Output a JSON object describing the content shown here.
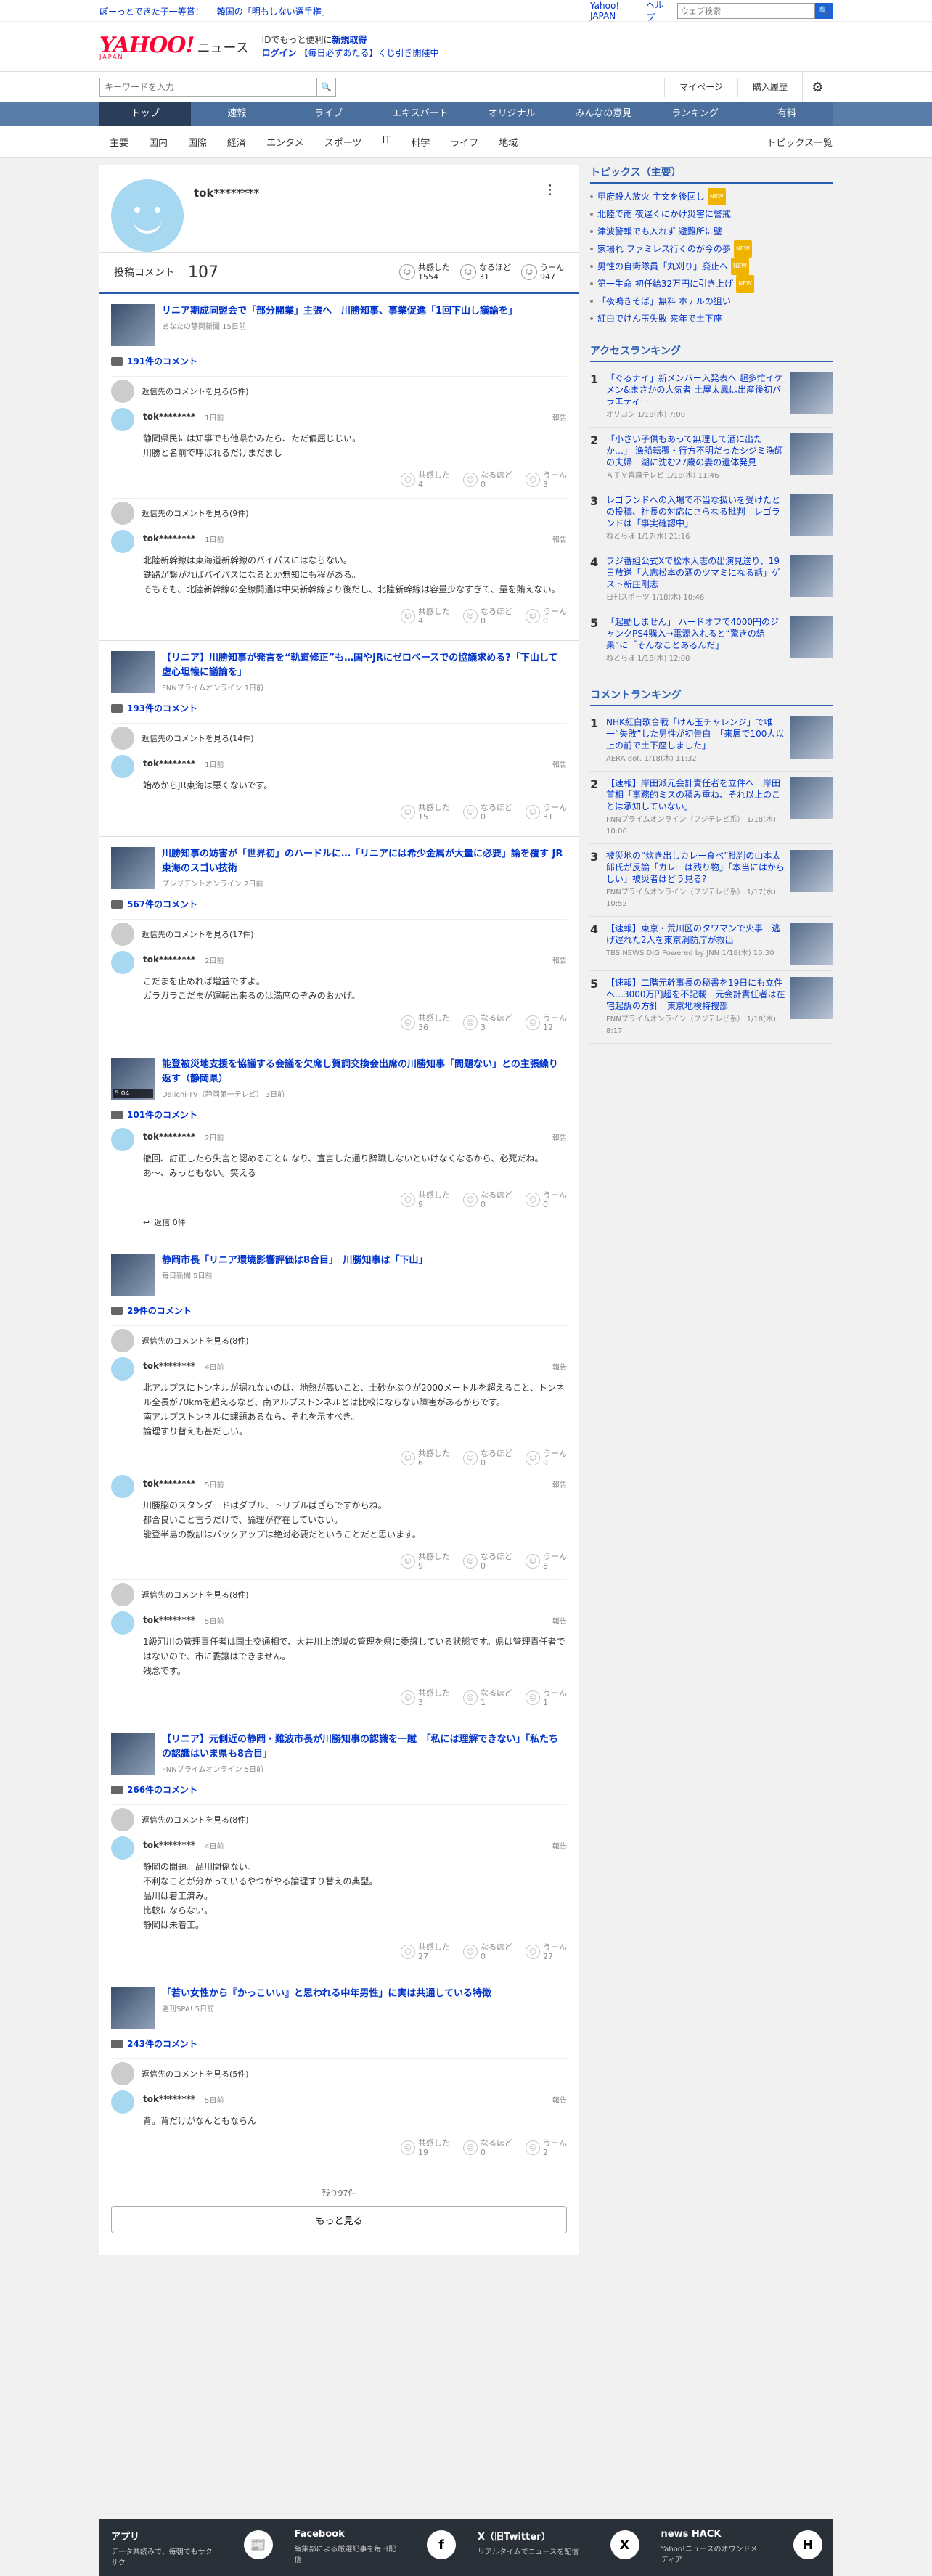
{
  "promo_links": [
    "ぽーっとできた子一等賞！",
    "韓国の「明もしない選手権」"
  ],
  "top_links": {
    "yahoo": "Yahoo! JAPAN",
    "help": "ヘルプ",
    "web_search_placeholder": "ウェブ検索"
  },
  "logo": {
    "main": "YAHOO!",
    "sub": "JAPAN",
    "service": "ニュース"
  },
  "header_note": {
    "line1": "IDでもっと便利に",
    "line1_link": "新規取得",
    "login": "ログイン",
    "lottery": "【毎日必ずあたる】くじ引き開催中"
  },
  "search": {
    "placeholder": "キーワードを入力"
  },
  "header_links": {
    "mypage": "マイページ",
    "purchase": "購入履歴"
  },
  "cat_tabs": [
    "トップ",
    "速報",
    "ライブ",
    "エキスパート",
    "オリジナル",
    "みんなの意見",
    "ランキング",
    "有料"
  ],
  "sub_tabs": [
    "主要",
    "国内",
    "国際",
    "経済",
    "エンタメ",
    "スポーツ",
    "IT",
    "科学",
    "ライフ",
    "地域"
  ],
  "sub_more": "トピックス一覧",
  "profile": {
    "name": "tok********",
    "post_label": "投稿コメント",
    "post_count": "107",
    "reacts": [
      {
        "label": "共感した",
        "count": "1554"
      },
      {
        "label": "なるほど",
        "count": "31"
      },
      {
        "label": "うーん",
        "count": "947"
      }
    ]
  },
  "articles": [
    {
      "title": "リニア期成同盟会で「部分開業」主張へ　川勝知事、事業促進「1回下山し議論を」",
      "source": "あなたの静岡新聞 15日前",
      "count": "191件のコメント",
      "threads": [
        {
          "reply": "返信先のコメントを見る(5件)",
          "time": "1日前",
          "body": "静岡県民には知事でも他県かみたら、ただ偏屈じじい。\n川勝と名前で呼ばれるだけまだまし",
          "r": [
            "共感した\n4",
            "なるほど\n0",
            "うーん\n3"
          ]
        },
        {
          "reply": "返信先のコメントを見る(9件)",
          "time": "1日前",
          "body": "北陸新幹線は東海道新幹線のバイパスにはならない。\n鉄路が繋がればバイパスになるとか無知にも程がある。\nそもそも、北陸新幹線の全線開通は中央新幹線より後だし、北陸新幹線は容量少なすぎて、量を賄えない。",
          "r": [
            "共感した\n4",
            "なるほど\n0",
            "うーん\n0"
          ]
        }
      ]
    },
    {
      "title": "【リニア】川勝知事が発言を“軌道修正”も…国やJRにゼロベースでの協議求める?「下山して虚心坦懐に議論を」",
      "source": "FNNプライムオンライン 1日前",
      "count": "193件のコメント",
      "threads": [
        {
          "reply": "返信先のコメントを見る(14件)",
          "time": "1日前",
          "body": "始めからJR東海は悪くないです。",
          "r": [
            "共感した\n15",
            "なるほど\n0",
            "うーん\n31"
          ]
        }
      ]
    },
    {
      "title": "川勝知事の妨害が「世界初」のハードルに…「リニアには希少金属が大量に必要」論を覆す JR東海のスゴい技術",
      "source": "プレジデントオンライン 2日前",
      "count": "567件のコメント",
      "threads": [
        {
          "reply": "返信先のコメントを見る(17件)",
          "time": "2日前",
          "body": "こだまを止めれば増益ですよ。\nガラガラこだまが運転出来るのは満席のぞみのおかげ。",
          "r": [
            "共感した\n36",
            "なるほど\n3",
            "うーん\n12"
          ]
        }
      ]
    },
    {
      "title": "能登被災地支援を協議する会議を欠席し賀詞交換会出席の川勝知事「問題ない」との主張繰り返す（静岡県）",
      "source": "Daiichi-TV（静岡第一テレビ） 3日前",
      "count": "101件のコメント",
      "video": "5:04",
      "threads": [
        {
          "reply": "",
          "time": "2日前",
          "body": "撤回、訂正したら失言と認めることになり、宣言した通り辞職しないといけなくなるから、必死だね。\nあ～、みっともない。笑える",
          "r": [
            "共感した\n9",
            "なるほど\n0",
            "うーん\n0"
          ]
        }
      ],
      "replies": "返信 0件"
    },
    {
      "title": "静岡市長「リニア環境影響評価は8合目」　川勝知事は「下山」",
      "source": "毎日新聞 5日前",
      "count": "29件のコメント",
      "threads": [
        {
          "reply": "返信先のコメントを見る(8件)",
          "time": "4日前",
          "body": "北アルプスにトンネルが掘れないのは、地熱が高いこと、土砂かぶりが2000メートルを超えること、トンネル全長が70kmを超えるなど、南アルプストンネルとは比較にならない障害があるからです。\n南アルプストンネルに課題あるなら、それを示すべき。\n論理すり替えも甚だしい。",
          "r": [
            "共感した\n6",
            "なるほど\n0",
            "うーん\n9"
          ]
        },
        {
          "reply": "",
          "time": "5日前",
          "body": "川勝脳のスタンダードはダブル、トリプルばざらですからね。\n都合良いこと言うだけで、論理が存在していない。\n能登半島の教訓はバックアップは絶対必要だということだと思います。",
          "r": [
            "共感した\n9",
            "なるほど\n0",
            "うーん\n8"
          ]
        },
        {
          "reply": "返信先のコメントを見る(8件)",
          "time": "5日前",
          "body": "1級河川の管理責任者は国土交通相で、大井川上流域の管理を県に委譲している状態です。県は管理責任者ではないので、市に委譲はできません。\n残念です。",
          "r": [
            "共感した\n3",
            "なるほど\n1",
            "うーん\n1"
          ]
        }
      ]
    },
    {
      "title": "【リニア】元側近の静岡・難波市長が川勝知事の認識を一蹴　「私には理解できない」「私たちの認識はいま県も8合目」",
      "source": "FNNプライムオンライン 5日前",
      "count": "266件のコメント",
      "threads": [
        {
          "reply": "返信先のコメントを見る(8件)",
          "time": "4日前",
          "body": "静岡の問題。品川関係ない。\n不利なことが分かっているやつがやる論理すり替えの典型。\n品川は着工済み。\n比較にならない。\n静岡は未着工。",
          "r": [
            "共感した\n27",
            "なるほど\n0",
            "うーん\n27"
          ]
        }
      ]
    },
    {
      "title": "「若い女性から『かっこいい』と思われる中年男性」に実は共通している特徴",
      "source": "週刊SPA! 5日前",
      "count": "243件のコメント",
      "threads": [
        {
          "reply": "返信先のコメントを見る(5件)",
          "time": "5日前",
          "body": "背。背だけがなんともならん",
          "r": [
            "共感した\n19",
            "なるほど\n0",
            "うーん\n2"
          ]
        }
      ]
    }
  ],
  "load_more": {
    "rest": "残り97件",
    "button": "もっと見る"
  },
  "report_label": "報告",
  "topics": {
    "title": "トピックス（主要）",
    "items": [
      {
        "t": "甲府殺人放火 主文を後回し",
        "b": "NEW"
      },
      {
        "t": "北陸で雨 夜遅くにかけ災害に警戒",
        "b": ""
      },
      {
        "t": "津波警報でも入れず 避難所に壁",
        "b": ""
      },
      {
        "t": "家場れ ファミレス行くのが今の夢",
        "b": "NEW"
      },
      {
        "t": "男性の自衛隊員「丸刈り」廃止へ",
        "b": "NEW"
      },
      {
        "t": "第一生命 初任給32万円に引き上げ",
        "b": "NEW"
      },
      {
        "t": "「夜鳴きそば」無料 ホテルの狙い",
        "b": ""
      },
      {
        "t": "紅白でけん玉失敗 来年で土下座",
        "b": ""
      }
    ]
  },
  "access_rank": {
    "title": "アクセスランキング",
    "items": [
      {
        "t": "「ぐるナイ」新メンバー入発表へ 超多忙イケメン&まさかの人気者 土屋太鳳は出産後初バラエティー",
        "s": "オリコン 1/18(木) 7:00"
      },
      {
        "t": "「小さい子供もあって無理して酒に出たか…」 漁船転覆・行方不明だったシジミ漁師の夫婦　湖に沈む27歳の妻の遺体発見",
        "s": "ＡＴＶ青森テレビ 1/18(木) 11:46"
      },
      {
        "t": "レゴランドへの入場で不当な扱いを受けたとの投稿、社長の対応にさらなる批判　レゴランドは「事実確認中」",
        "s": "ねとらぼ 1/17(水) 21:16"
      },
      {
        "t": "フジ番組公式Xで松本人志の出演見送り、19日放送「人志松本の酒のツマミになる話」ゲスト新庄剛志",
        "s": "日刊スポーツ 1/18(木) 10:46"
      },
      {
        "t": "「起動しません」 ハードオフで4000円のジャンクPS4購入→電源入れると“驚きの結果”に「そんなことあるんだ」",
        "s": "ねとらぼ 1/18(木) 12:00"
      }
    ]
  },
  "comment_rank": {
    "title": "コメントランキング",
    "items": [
      {
        "t": "NHK紅白歌合戦「けん玉チャレンジ」で唯一“失敗”した男性が初告白　「来層で100人以上の前で土下座しました」",
        "s": "AERA dot. 1/18(木) 11:32"
      },
      {
        "t": "【速報】岸田派元会計責任者を立件へ　岸田首相「事務的ミスの積み重ね、それ以上のことは承知していない」",
        "s": "FNNプライムオンライン（フジテレビ系） 1/18(木) 10:06"
      },
      {
        "t": "被災地の“炊き出しカレー食べ”批判の山本太郎氏が反論「カレーは残り物」「本当にはからしい」被災者はどう見る?",
        "s": "FNNプライムオンライン（フジテレビ系） 1/17(水) 10:52"
      },
      {
        "t": "【速報】東京・荒川区のタワマンで火事　逃げ遅れた2人を東京消防庁が救出",
        "s": "TBS NEWS DIG Powered by JNN 1/18(木) 10:30"
      },
      {
        "t": "【速報】二階元幹事長の秘書を19日にも立件へ…3000万円超を不記載　元会計責任者は在宅起訴の方針　東京地検特捜部",
        "s": "FNNプライムオンライン（フジテレビ系） 1/18(木) 8:17"
      }
    ]
  },
  "footer": [
    {
      "t": "アプリ",
      "d": "データ共読みで、毎朝でもサクサク",
      "i": "📰"
    },
    {
      "t": "Facebook",
      "d": "編集部による厳選記事を毎日配信",
      "i": "f"
    },
    {
      "t": "X（旧Twitter）",
      "d": "リアルタイムでニュースを配信",
      "i": "X"
    },
    {
      "t": "news HACK",
      "d": "Yahoo!ニュースのオウンドメディア",
      "i": "H"
    }
  ]
}
